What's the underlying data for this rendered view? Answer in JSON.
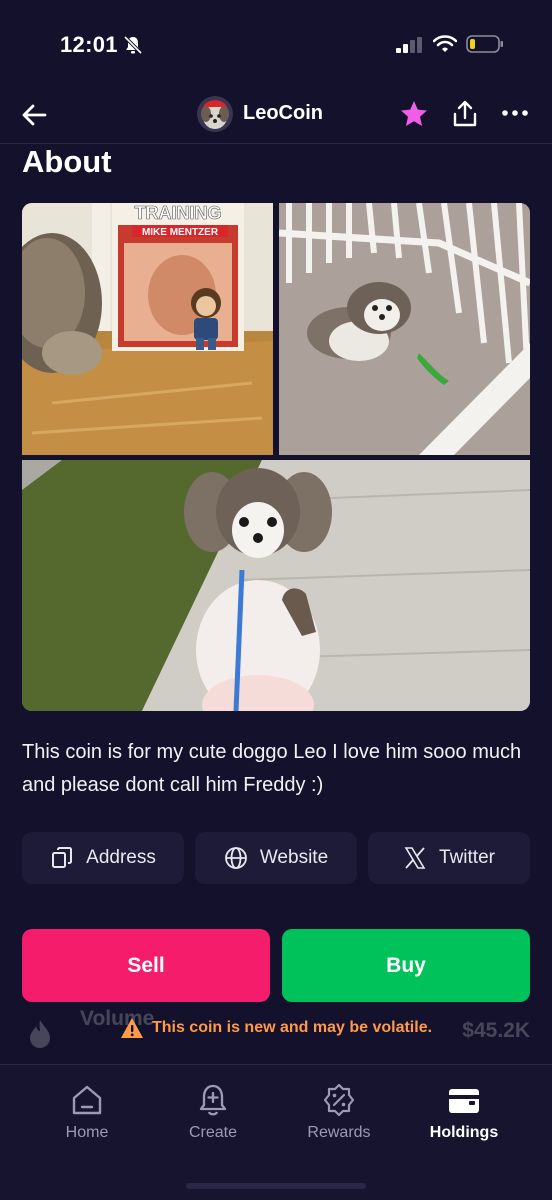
{
  "status_bar": {
    "time": "12:01"
  },
  "header": {
    "coin_name": "LeoCoin",
    "star_color": "#f05ee8"
  },
  "about": {
    "title": "About",
    "photo_caption_training": "TRAINING",
    "photo_caption_mentzer": "MIKE MENTZER",
    "description": "This coin is for my cute doggo Leo I love him sooo much and please dont call him Freddy :)"
  },
  "links": {
    "address_label": "Address",
    "website_label": "Website",
    "twitter_label": "Twitter"
  },
  "actions": {
    "sell_label": "Sell",
    "buy_label": "Buy",
    "sell_color": "#f61c6c",
    "buy_color": "#00c25a"
  },
  "stats_row": {
    "label": "Volume",
    "value": "$45.2K"
  },
  "warning": {
    "text": "This coin is new and may be volatile.",
    "color": "#ff9a4a"
  },
  "tabs": [
    {
      "label": "Home",
      "icon": "home-icon"
    },
    {
      "label": "Create",
      "icon": "bell-plus-icon"
    },
    {
      "label": "Rewards",
      "icon": "percent-badge-icon"
    },
    {
      "label": "Holdings",
      "icon": "wallet-icon"
    }
  ],
  "active_tab": "Holdings"
}
